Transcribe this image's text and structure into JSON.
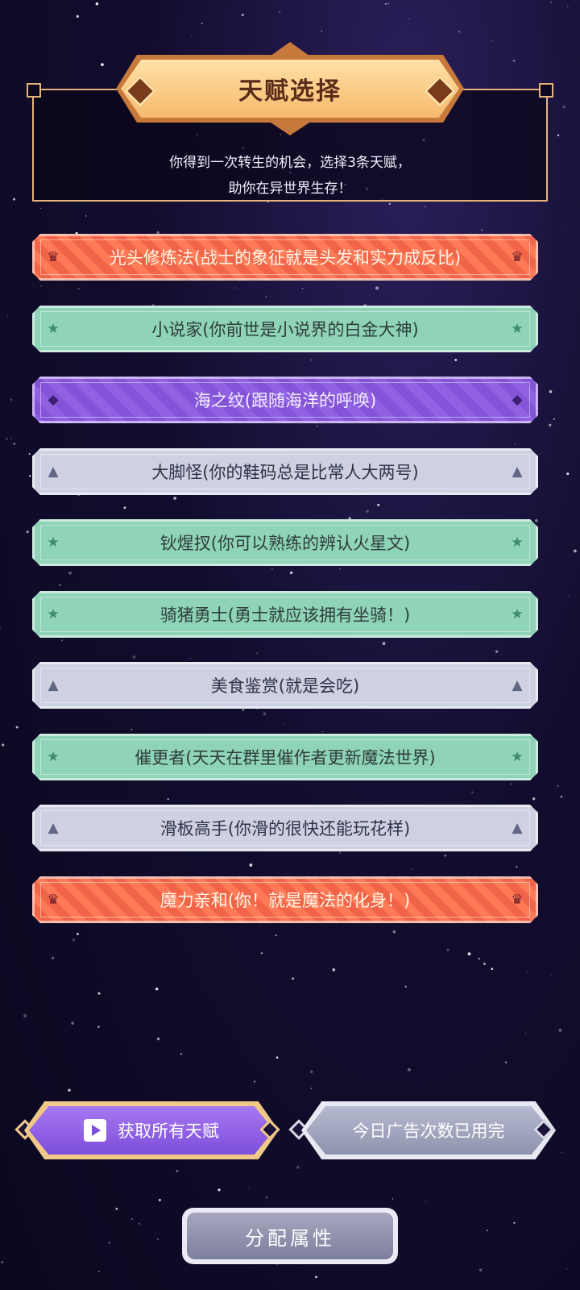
{
  "header": {
    "title": "天赋选择",
    "description": "你得到一次转生的机会，选择3条天赋，\n助你在异世界生存！"
  },
  "talents": [
    {
      "label": "光头修炼法(战士的象征就是头发和实力成反比)",
      "rarity": "orange",
      "icon": "crown-icon"
    },
    {
      "label": "小说家(你前世是小说界的白金大神)",
      "rarity": "green",
      "icon": "star-icon"
    },
    {
      "label": "海之纹(跟随海洋的呼唤)",
      "rarity": "purple",
      "icon": "diamond-icon"
    },
    {
      "label": "大脚怪(你的鞋码总是比常人大两号)",
      "rarity": "gray",
      "icon": "triangle-icon"
    },
    {
      "label": "钬煋扠(你可以熟练的辨认火星文)",
      "rarity": "green",
      "icon": "star-icon"
    },
    {
      "label": "骑猪勇士(勇士就应该拥有坐骑！)",
      "rarity": "green",
      "icon": "star-icon"
    },
    {
      "label": "美食鉴赏(就是会吃)",
      "rarity": "gray",
      "icon": "triangle-icon"
    },
    {
      "label": "催更者(天天在群里催作者更新魔法世界)",
      "rarity": "green",
      "icon": "star-icon"
    },
    {
      "label": "滑板高手(你滑的很快还能玩花样)",
      "rarity": "gray",
      "icon": "triangle-icon"
    },
    {
      "label": "魔力亲和(你！就是魔法的化身！)",
      "rarity": "orange",
      "icon": "crown-icon"
    }
  ],
  "buttons": {
    "get_all": "获取所有天赋",
    "ads_used": "今日广告次数已用完",
    "assign": "分配属性"
  },
  "colors": {
    "orange": "#f26447",
    "green": "#8fd3b8",
    "purple": "#8454d8",
    "gray": "#cdd1e2",
    "accent_gold": "#e8b37a"
  }
}
